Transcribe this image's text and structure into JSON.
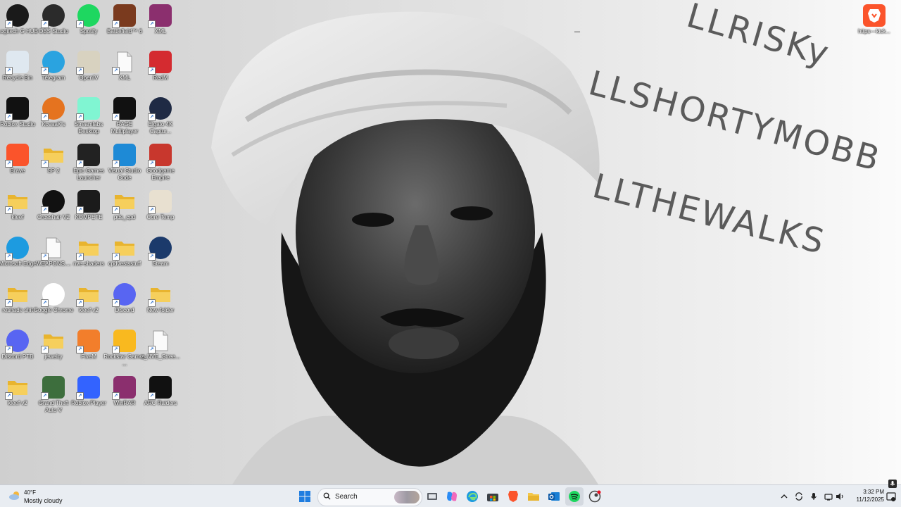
{
  "desktop": {
    "wallpaper_text": [
      "LLRISKy",
      "LLSHORTYMOBB",
      "LLTHEWALKS"
    ],
    "icons": [
      {
        "label": "Logitech G HUB",
        "icon": "logitech-g-icon",
        "color": "#1a1a1a"
      },
      {
        "label": "OBS Studio",
        "icon": "obs-icon",
        "color": "#2b2b2b"
      },
      {
        "label": "Spotify",
        "icon": "spotify-icon",
        "color": "#1ed760"
      },
      {
        "label": "Battlefield™ 6",
        "icon": "battlefield-icon",
        "color": "#7a3a1e"
      },
      {
        "label": "XML",
        "icon": "winrar-icon",
        "color": "#8b2f6e"
      },
      {
        "label": "Recycle Bin",
        "icon": "recycle-bin-icon",
        "color": "#dfe8f0"
      },
      {
        "label": "Telegram",
        "icon": "telegram-icon",
        "color": "#2aa3e0"
      },
      {
        "label": "OpenIV",
        "icon": "openiv-icon",
        "color": "#d8d2c0"
      },
      {
        "label": "XML",
        "icon": "document-icon",
        "color": "#f0f0f0"
      },
      {
        "label": "RedM",
        "icon": "redm-icon",
        "color": "#d42b30"
      },
      {
        "label": "Roblox Studio",
        "icon": "roblox-studio-icon",
        "color": "#111111"
      },
      {
        "label": "KovaaK's",
        "icon": "kovaaks-icon",
        "color": "#e5731f"
      },
      {
        "label": "Streamlabs Desktop",
        "icon": "streamlabs-icon",
        "color": "#80f5d2"
      },
      {
        "label": "RAGE Multiplayer",
        "icon": "rage-mp-icon",
        "color": "#111111"
      },
      {
        "label": "Elgato 4K Captur...",
        "icon": "elgato-4k-icon",
        "color": "#1f2a44"
      },
      {
        "label": "Brave",
        "icon": "brave-icon",
        "color": "#fb542b"
      },
      {
        "label": "SP 2",
        "icon": "folder-icon",
        "color": "#f3c74a"
      },
      {
        "label": "Epic Games Launcher",
        "icon": "epic-games-icon",
        "color": "#222222"
      },
      {
        "label": "Visual Studio Code",
        "icon": "vscode-icon",
        "color": "#1e8ad6"
      },
      {
        "label": "Goodgame Empire",
        "icon": "goodgame-empire-icon",
        "color": "#c8372d"
      },
      {
        "label": "kleef",
        "icon": "folder-icon",
        "color": "#f3c74a"
      },
      {
        "label": "Crosshair V2",
        "icon": "crosshair-icon",
        "color": "#111111"
      },
      {
        "label": "KOMPETE",
        "icon": "kompete-icon",
        "color": "#1b1b1b"
      },
      {
        "label": "pds_cpd",
        "icon": "folder-icon",
        "color": "#f3c74a"
      },
      {
        "label": "Core Temp",
        "icon": "core-temp-icon",
        "color": "#e8e0d0"
      },
      {
        "label": "Microsoft Edge",
        "icon": "edge-icon",
        "color": "#1d9be0"
      },
      {
        "label": "WEAPONS....",
        "icon": "document-icon",
        "color": "#f0f0f0"
      },
      {
        "label": "nve-shaders",
        "icon": "folder-icon",
        "color": "#f3c74a"
      },
      {
        "label": "cpdvestsstuff",
        "icon": "folder-icon",
        "color": "#f3c74a"
      },
      {
        "label": "Steam",
        "icon": "steam-icon",
        "color": "#1b3a6b"
      },
      {
        "label": "reshade shit",
        "icon": "folder-icon",
        "color": "#f3c74a"
      },
      {
        "label": "Google Chrome",
        "icon": "chrome-icon",
        "color": "#ffffff"
      },
      {
        "label": "kleef v2",
        "icon": "folder-icon",
        "color": "#f3c74a"
      },
      {
        "label": "Discord",
        "icon": "discord-icon",
        "color": "#5865f2"
      },
      {
        "label": "New folder",
        "icon": "folder-icon",
        "color": "#f3c74a"
      },
      {
        "label": "Discord PTB",
        "icon": "discord-ptb-icon",
        "color": "#5865f2"
      },
      {
        "label": "jewelry",
        "icon": "folder-icon",
        "color": "#f3c74a"
      },
      {
        "label": "FiveM",
        "icon": "fivem-icon",
        "color": "#f27e2b"
      },
      {
        "label": "Rockstar Games ...",
        "icon": "rockstar-icon",
        "color": "#f9b91f"
      },
      {
        "label": "z_NVE_Stree...",
        "icon": "document-icon",
        "color": "#f0f0f0"
      },
      {
        "label": "kleef v2",
        "icon": "folder-icon",
        "color": "#f3c74a"
      },
      {
        "label": "Grand Theft Auto V",
        "icon": "gta-v-icon",
        "color": "#3d6e3d"
      },
      {
        "label": "Roblox Player",
        "icon": "roblox-player-icon",
        "color": "#3363ff"
      },
      {
        "label": "WinRAR",
        "icon": "winrar-icon",
        "color": "#8b2f6e"
      },
      {
        "label": "ARC Raiders",
        "icon": "arc-raiders-icon",
        "color": "#111111"
      }
    ],
    "corner_icon": {
      "label": "https---kick...",
      "icon": "brave-icon",
      "color": "#fb542b"
    }
  },
  "taskbar": {
    "weather": {
      "temp": "40°F",
      "condition": "Mostly cloudy",
      "icon": "cloud-icon"
    },
    "search_label": "Search",
    "pinned": [
      "start-icon",
      "task-view-icon",
      "copilot-icon",
      "edge-icon",
      "store-icon",
      "brave-icon",
      "file-explorer-icon",
      "outlook-icon",
      "spotify-icon",
      "steam-icon"
    ],
    "tray": [
      "chevron-up-icon",
      "sync-icon",
      "microphone-icon",
      "volume-icon",
      "network-icon"
    ],
    "time": "3:32 PM",
    "date": "11/12/2025"
  }
}
